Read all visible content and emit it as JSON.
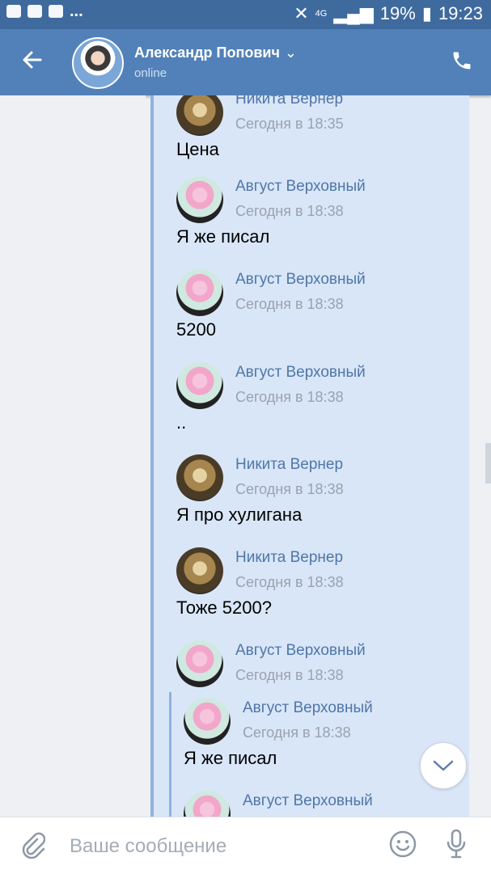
{
  "statusbar": {
    "network": "4G",
    "battery": "19%",
    "time": "19:23",
    "dots": "..."
  },
  "header": {
    "name": "Александр Попович",
    "status": "online"
  },
  "messages": [
    {
      "author": "Никита Вернер",
      "time": "Сегодня в 18:35",
      "text": "Цена",
      "avatar": "cat"
    },
    {
      "author": "Август Верховный",
      "time": "Сегодня в 18:38",
      "text": "Я же писал",
      "avatar": "girl"
    },
    {
      "author": "Август Верховный",
      "time": "Сегодня в 18:38",
      "text": "5200",
      "avatar": "girl"
    },
    {
      "author": "Август Верховный",
      "time": "Сегодня в 18:38",
      "text": "..",
      "avatar": "girl"
    },
    {
      "author": "Никита Вернер",
      "time": "Сегодня в 18:38",
      "text": "Я про хулигана",
      "avatar": "cat"
    },
    {
      "author": "Никита Вернер",
      "time": "Сегодня в 18:38",
      "text": "Тоже 5200?",
      "avatar": "cat"
    },
    {
      "author": "Август Верховный",
      "time": "Сегодня в 18:38",
      "text": "",
      "avatar": "girl"
    }
  ],
  "nested": [
    {
      "author": "Август Верховный",
      "time": "Сегодня в 18:38",
      "text": "Я же писал",
      "avatar": "girl"
    },
    {
      "author": "Август Верховный",
      "time": "",
      "text": "",
      "avatar": "girl"
    }
  ],
  "input": {
    "placeholder": "Ваше сообщение"
  }
}
